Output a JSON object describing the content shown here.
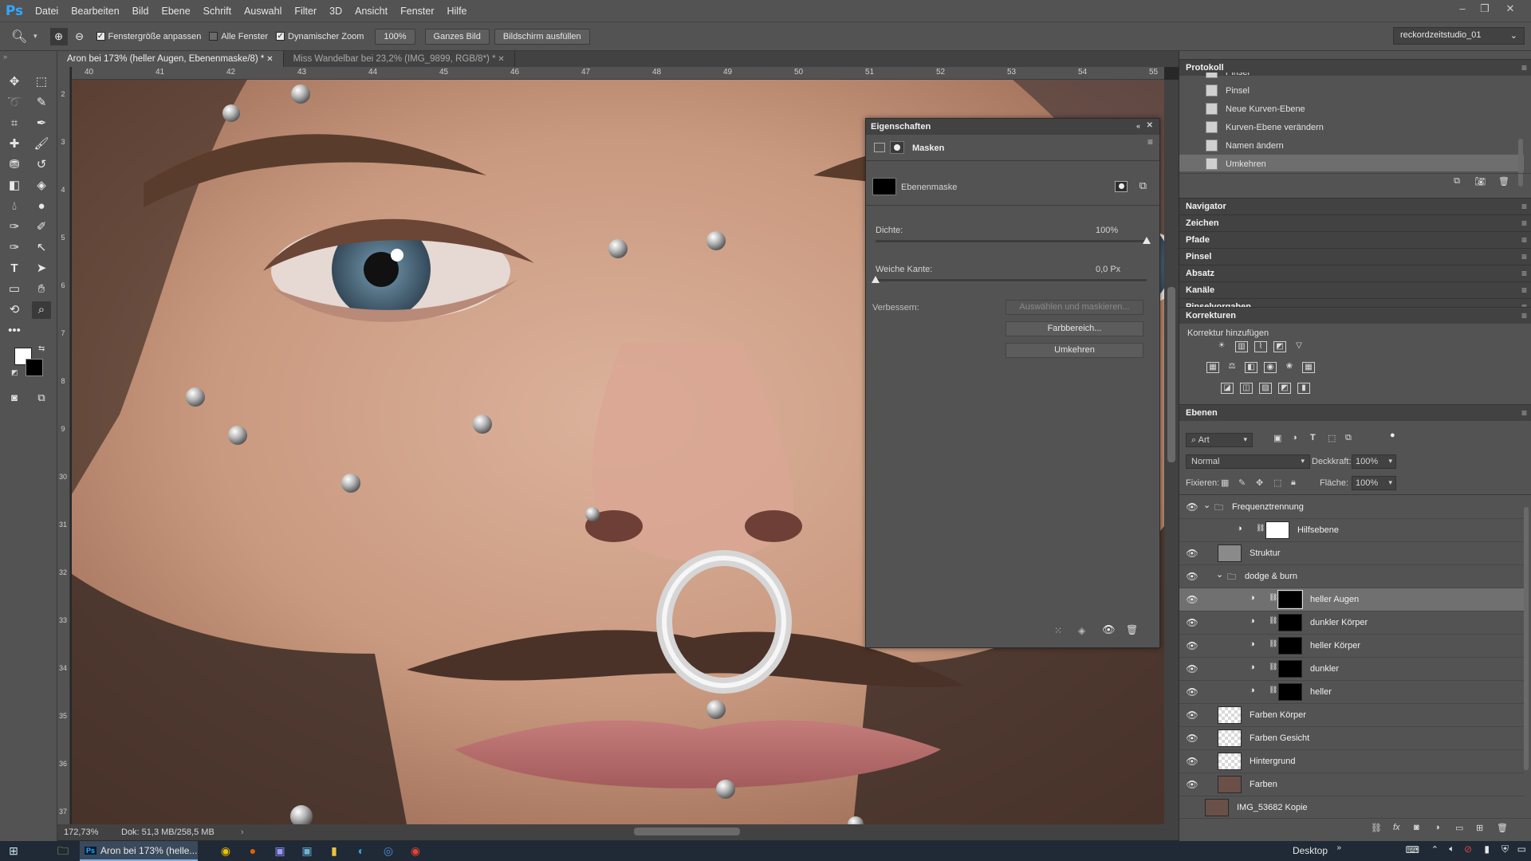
{
  "app": {
    "logo": "Ps"
  },
  "menu": [
    "Datei",
    "Bearbeiten",
    "Bild",
    "Ebene",
    "Schrift",
    "Auswahl",
    "Filter",
    "3D",
    "Ansicht",
    "Fenster",
    "Hilfe"
  ],
  "options": {
    "fit_window": "Fenstergröße anpassen",
    "all_windows": "Alle Fenster",
    "scrubby_zoom": "Dynamischer Zoom",
    "zoom_100": "100%",
    "fit_screen": "Ganzes Bild",
    "fill_screen": "Bildschirm ausfüllen",
    "workspace": "reckordzeitstudio_01"
  },
  "tabs": [
    {
      "label": "Aron bei 173% (heller Augen, Ebenenmaske/8) *",
      "active": true
    },
    {
      "label": "Miss Wandelbar bei 23,2% (IMG_9899, RGB/8*) *",
      "active": false
    }
  ],
  "ruler": {
    "top": [
      "40",
      "41",
      "42",
      "43",
      "44",
      "45",
      "46",
      "47",
      "48",
      "49",
      "50",
      "51",
      "52",
      "53",
      "54",
      "55"
    ],
    "left": [
      "2",
      "3",
      "4",
      "5",
      "6",
      "7",
      "8",
      "9",
      "30",
      "31",
      "32",
      "33",
      "34",
      "35",
      "36",
      "37"
    ]
  },
  "status": {
    "zoom": "172,73%",
    "doc": "Dok: 51,3 MB/258,5 MB"
  },
  "properties": {
    "title": "Eigenschaften",
    "section": "Masken",
    "mask_name": "Ebenenmaske",
    "density_label": "Dichte:",
    "density_value": "100%",
    "density": 1.0,
    "feather_label": "Weiche Kante:",
    "feather_value": "0,0 Px",
    "feather": 0.0,
    "refine_label": "Verbessern:",
    "btn_select_mask": "Auswählen und maskieren...",
    "btn_color_range": "Farbbereich...",
    "btn_invert": "Umkehren"
  },
  "history": {
    "title": "Protokoll",
    "items": [
      {
        "label": "Pinsel",
        "selected": false
      },
      {
        "label": "Pinsel",
        "selected": false
      },
      {
        "label": "Neue Kurven-Ebene",
        "selected": false
      },
      {
        "label": "Kurven-Ebene verändern",
        "selected": false
      },
      {
        "label": "Namen ändern",
        "selected": false
      },
      {
        "label": "Umkehren",
        "selected": true
      }
    ]
  },
  "collapsed_panels": [
    "Navigator",
    "Zeichen",
    "Pfade",
    "Pinsel",
    "Absatz",
    "Kanäle",
    "Pinselvorgaben"
  ],
  "adjustments": {
    "title": "Korrekturen",
    "subtitle": "Korrektur hinzufügen"
  },
  "layers_panel": {
    "title": "Ebenen",
    "filter": "Art",
    "blend": "Normal",
    "opacity_label": "Deckkraft:",
    "opacity": "100%",
    "lock_label": "Fixieren:",
    "fill_label": "Fläche:",
    "fill": "100%",
    "layers": [
      {
        "name": "Frequenztrennung",
        "type": "group",
        "visible": true,
        "indent": 0,
        "selected": false
      },
      {
        "name": "Hilfsebene",
        "type": "adjustment-white",
        "visible": false,
        "indent": 1,
        "selected": false
      },
      {
        "name": "Struktur",
        "type": "gray",
        "visible": true,
        "indent": 1,
        "selected": false
      },
      {
        "name": "dodge & burn",
        "type": "group",
        "visible": true,
        "indent": 1,
        "selected": false
      },
      {
        "name": "heller Augen",
        "type": "adjustment-black",
        "visible": true,
        "indent": 2,
        "selected": true
      },
      {
        "name": "dunkler Körper",
        "type": "adjustment-black",
        "visible": true,
        "indent": 2,
        "selected": false
      },
      {
        "name": "heller Körper",
        "type": "adjustment-black",
        "visible": true,
        "indent": 2,
        "selected": false
      },
      {
        "name": "dunkler",
        "type": "adjustment-black",
        "visible": true,
        "indent": 2,
        "selected": false
      },
      {
        "name": "heller",
        "type": "adjustment-black",
        "visible": true,
        "indent": 2,
        "selected": false
      },
      {
        "name": "Farben Körper",
        "type": "transparent",
        "visible": true,
        "indent": 1,
        "selected": false
      },
      {
        "name": "Farben Gesicht",
        "type": "transparent",
        "visible": true,
        "indent": 1,
        "selected": false
      },
      {
        "name": "Hintergrund",
        "type": "transparent",
        "visible": true,
        "indent": 1,
        "selected": false
      },
      {
        "name": "Farben",
        "type": "photo",
        "visible": true,
        "indent": 1,
        "selected": false
      },
      {
        "name": "IMG_53682 Kopie",
        "type": "photo",
        "visible": false,
        "indent": 0,
        "selected": false
      }
    ]
  },
  "taskbar": {
    "active_window": "Aron bei 173% (helle...",
    "desktop": "Desktop"
  },
  "colors": {
    "accent": "#31a8ff",
    "panel": "#535353",
    "dark": "#424242"
  }
}
